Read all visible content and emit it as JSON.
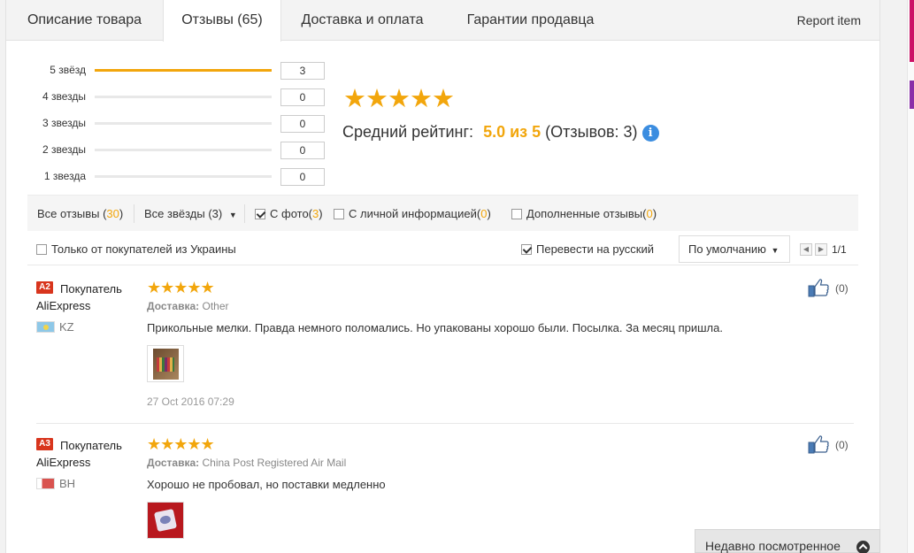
{
  "tabs": [
    {
      "label": "Описание товара"
    },
    {
      "label": "Отзывы (65)"
    },
    {
      "label": "Доставка и оплата"
    },
    {
      "label": "Гарантии продавца"
    }
  ],
  "report_item": "Report item",
  "rating_breakdown": [
    {
      "label": "5 звёзд",
      "count": "3",
      "fraction": 1.0
    },
    {
      "label": "4 звезды",
      "count": "0",
      "fraction": 0
    },
    {
      "label": "3 звезды",
      "count": "0",
      "fraction": 0
    },
    {
      "label": "2 звезды",
      "count": "0",
      "fraction": 0
    },
    {
      "label": "1 звезда",
      "count": "0",
      "fraction": 0
    }
  ],
  "summary": {
    "stars": "★★★★★",
    "avg_label": "Средний рейтинг:",
    "score": "5.0 из 5",
    "reviews_count": "(Отзывов: 3)",
    "info_glyph": "i"
  },
  "filters": {
    "all_label": "Все отзывы (",
    "all_count": "30",
    "all_close": ")",
    "stars_select": "Все звёзды (3)",
    "photo_label": "С фото(",
    "photo_count": "3",
    "photo_checked": true,
    "personal_label": "С личной информацией(",
    "personal_count": "0",
    "personal_checked": false,
    "supplemented_label": "Дополненные отзывы(",
    "supplemented_count": "0",
    "supplemented_checked": false,
    "close_paren": ")"
  },
  "options": {
    "ukraine_label": "Только от покупателей из Украины",
    "ukraine_checked": false,
    "translate_label": "Перевести на русский",
    "translate_checked": true,
    "sort_label": "По умолчанию",
    "page": "1/1"
  },
  "reviews": [
    {
      "badge": "A2",
      "buyer": "Покупатель AliExpress",
      "country": "KZ",
      "flag_colors": [
        "#8ec8e8",
        "#f2d44a"
      ],
      "stars": "★★★★★",
      "delivery_label": "Доставка:",
      "delivery_value": "Other",
      "text": "Прикольные мелки. Правда немного поломались. Но упакованы хорошо были. Посылка. За месяц пришла.",
      "date": "27 Oct 2016 07:29",
      "likes": "(0)"
    },
    {
      "badge": "A3",
      "buyer": "Покупатель AliExpress",
      "country": "BH",
      "flag_colors": [
        "#ffffff",
        "#d9534f"
      ],
      "stars": "★★★★★",
      "delivery_label": "Доставка:",
      "delivery_value": "China Post Registered Air Mail",
      "text": "Хорошо не пробовал, но поставки медленно",
      "date": "",
      "likes": "(0)"
    }
  ],
  "recently_viewed": "Недавно посмотренное",
  "colors": {
    "accent": "#f2a60c",
    "badge": "#d8351d",
    "info": "#3b8de0"
  }
}
